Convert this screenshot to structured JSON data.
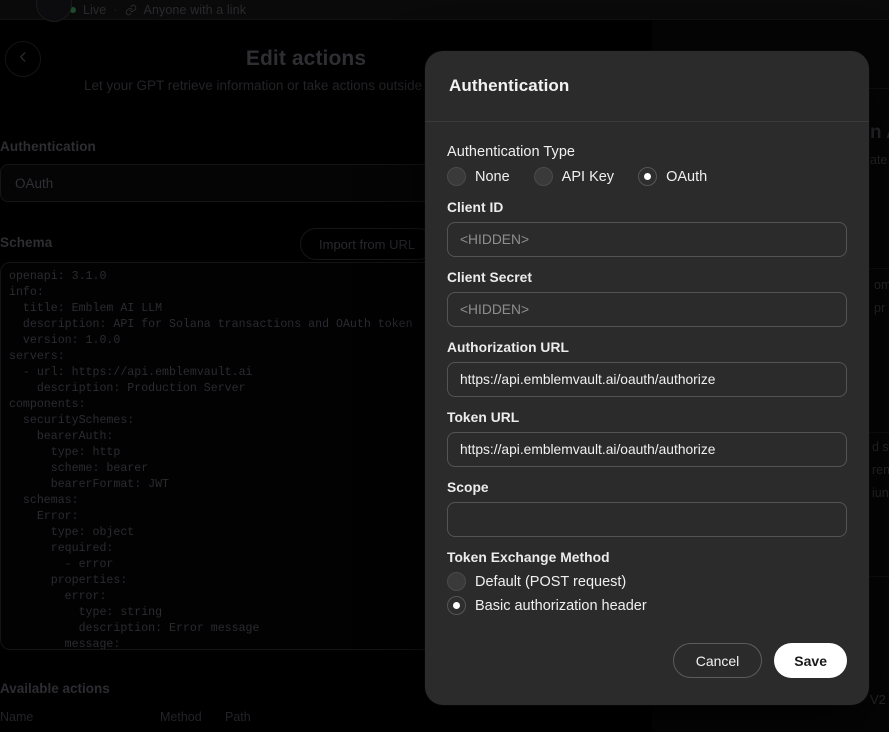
{
  "background": {
    "topbar": {
      "status_dot": "live",
      "status_label": "Live",
      "separator": "·",
      "visibility_icon": "link-icon",
      "visibility_label": "Anyone with a link"
    },
    "back_icon": "chevron-left-icon",
    "page_title": "Edit actions",
    "page_subtitle": "Let your GPT retrieve information or take actions outside of ChatGPT. Learn more.",
    "authentication_label": "Authentication",
    "authentication_value": "OAuth",
    "schema_label": "Schema",
    "import_button": "Import from URL",
    "schema_code": "openapi: 3.1.0\ninfo:\n  title: Emblem AI LLM\n  description: API for Solana transactions and OAuth token\n  version: 1.0.0\nservers:\n  - url: https://api.emblemvault.ai\n    description: Production Server\ncomponents:\n  securitySchemes:\n    bearerAuth:\n      type: http\n      scheme: bearer\n      bearerFormat: JWT\n  schemas:\n    Error:\n      type: object\n      required:\n        - error\n      properties:\n        error:\n          type: string\n          description: Error message\n        message:",
    "available_actions_label": "Available actions",
    "table_headers": [
      "Name",
      "Method",
      "Path"
    ],
    "right_column_fragments": [
      "n A",
      "ate",
      "om",
      "pr",
      "d s",
      "ren",
      "iun",
      "V2"
    ]
  },
  "modal": {
    "title": "Authentication",
    "auth_type": {
      "label": "Authentication Type",
      "options": [
        {
          "label": "None",
          "selected": false
        },
        {
          "label": "API Key",
          "selected": false
        },
        {
          "label": "OAuth",
          "selected": true
        }
      ]
    },
    "fields": [
      {
        "name": "client_id",
        "label": "Client ID",
        "value": "",
        "placeholder": "<HIDDEN>"
      },
      {
        "name": "client_secret",
        "label": "Client Secret",
        "value": "",
        "placeholder": "<HIDDEN>"
      },
      {
        "name": "authorization_url",
        "label": "Authorization URL",
        "value": "https://api.emblemvault.ai/oauth/authorize",
        "placeholder": ""
      },
      {
        "name": "token_url",
        "label": "Token URL",
        "value": "https://api.emblemvault.ai/oauth/authorize",
        "placeholder": ""
      },
      {
        "name": "scope",
        "label": "Scope",
        "value": "",
        "placeholder": ""
      }
    ],
    "token_exchange": {
      "label": "Token Exchange Method",
      "options": [
        {
          "label": "Default (POST request)",
          "selected": false
        },
        {
          "label": "Basic authorization header",
          "selected": true
        }
      ]
    },
    "cancel_label": "Cancel",
    "save_label": "Save"
  },
  "colors": {
    "modal_bg": "#2b2b2b",
    "page_bg": "#000000",
    "save_bg": "#ffffff",
    "accent_text": "#f2f2f2",
    "live_green": "#1d4b2c"
  }
}
